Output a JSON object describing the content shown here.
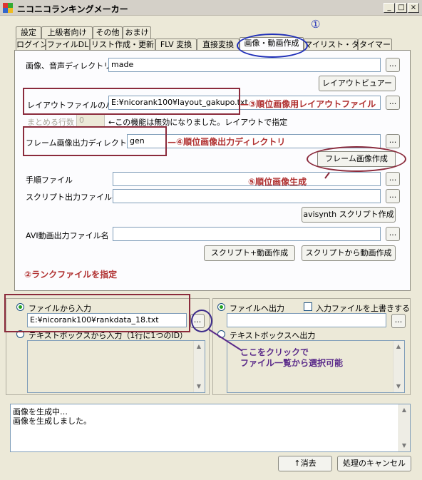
{
  "window": {
    "title": "ニコニコランキングメーカー",
    "min": "_",
    "max": "□",
    "close": "×"
  },
  "tabs_row1": [
    "設定",
    "上級者向け",
    "その他",
    "おまけ"
  ],
  "tabs_row2": [
    "ログイン",
    "ファイルDL",
    "リスト作成・更新",
    "FLV 変換",
    "直接変換",
    "画像・動画作成",
    "マイリスト・タグ",
    "タイマー"
  ],
  "main": {
    "image_audio_dir_label": "画像、音声ディレクトリ",
    "image_audio_dir_value": "made",
    "layout_viewer_button": "レイアウトビュアー",
    "layout_path_label": "レイアウトファイルのパス",
    "layout_path_value": "E:¥nicorank100¥layout_gakupo.txt",
    "group_rows_label": "まとめる行数",
    "group_rows_value": "0",
    "group_rows_note": "←この機能は無効になりました。レイアウトで指定",
    "frame_dir_label": "フレーム画像出力ディレクトリ",
    "frame_dir_value": "gen",
    "frame_create_button": "フレーム画像作成",
    "procedure_label": "手順ファイル",
    "script_out_label": "スクリプト出力ファイル名",
    "avisynth_button": "avisynth スクリプト作成",
    "avi_out_label": "AVI動画出力ファイル名",
    "script_video_button": "スクリプト+動画作成",
    "video_from_script_button": "スクリプトから動画作成",
    "browse": "..."
  },
  "input": {
    "from_file_label": "ファイルから入力",
    "file_value": "E:¥nicorank100¥rankdata_18.txt",
    "from_textbox_label": "テキストボックスから入力（1行に1つのID）"
  },
  "output": {
    "to_file_label": "ファイルへ出力",
    "overwrite_label": "入力ファイルを上書きする",
    "to_textbox_label": "テキストボックスへ出力"
  },
  "log": [
    "画像を生成中…",
    "画像を生成しました。"
  ],
  "footer": {
    "clear_button": "↑消去",
    "cancel_button": "処理のキャンセル"
  },
  "annotations": {
    "circle1": "①",
    "step2": "②ランクファイルを指定",
    "step3": "—③順位画像用レイアウトファイル",
    "step4": "—④順位画像出力ディレクトリ",
    "step5": "⑤順位画像生成",
    "click_note_line1": "ここをクリックで",
    "click_note_line2": "ファイル一覧から選択可能"
  },
  "colors": {
    "annotation_red": "#b03030",
    "annotation_purple": "#5b2b8a",
    "annotation_blue": "#1f2fb8"
  }
}
